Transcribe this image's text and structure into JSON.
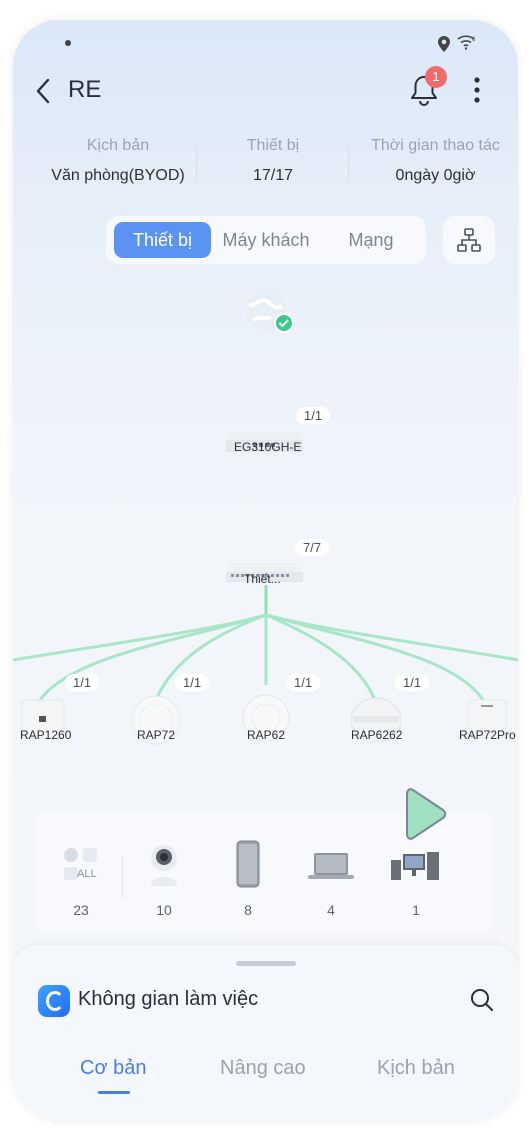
{
  "header": {
    "title": "RE",
    "notification_count": "1"
  },
  "stats": [
    {
      "label": "Kịch bản",
      "value": "Văn phòng(BYOD)"
    },
    {
      "label": "Thiết bị",
      "value": "17/17"
    },
    {
      "label": "Thời gian thao tác",
      "value": "0ngày 0giờ"
    }
  ],
  "segments": [
    {
      "label": "Thiết bị",
      "active": true
    },
    {
      "label": "Máy khách",
      "active": false
    },
    {
      "label": "Mạng",
      "active": false
    }
  ],
  "topology": {
    "gateway": {
      "name": "EG310GH-E",
      "ratio": "1/1"
    },
    "switch": {
      "name": "Thiết...",
      "ratio": "7/7"
    },
    "aps": [
      {
        "name": "RAP1260",
        "ratio": "1/1"
      },
      {
        "name": "RAP72",
        "ratio": "1/1"
      },
      {
        "name": "RAP62",
        "ratio": "1/1"
      },
      {
        "name": "RAP6262",
        "ratio": "1/1"
      },
      {
        "name": "RAP72Pro",
        "ratio": ""
      }
    ]
  },
  "clients": [
    {
      "icon": "all-clients-icon",
      "label": "ALL",
      "count": "23"
    },
    {
      "icon": "camera-icon",
      "count": "10"
    },
    {
      "icon": "phone-icon",
      "count": "8"
    },
    {
      "icon": "laptop-icon",
      "count": "4"
    },
    {
      "icon": "devices-icon",
      "count": "1"
    }
  ],
  "workspace": {
    "title": "Không gian làm việc",
    "tabs": [
      {
        "label": "Cơ bản",
        "active": true
      },
      {
        "label": "Nâng cao",
        "active": false
      },
      {
        "label": "Kịch bản",
        "active": false
      }
    ]
  },
  "colors": {
    "accent": "#5b93f3",
    "link_line": "#8fe0b8",
    "badge": "#f06b6b",
    "online": "#3cc98a"
  }
}
